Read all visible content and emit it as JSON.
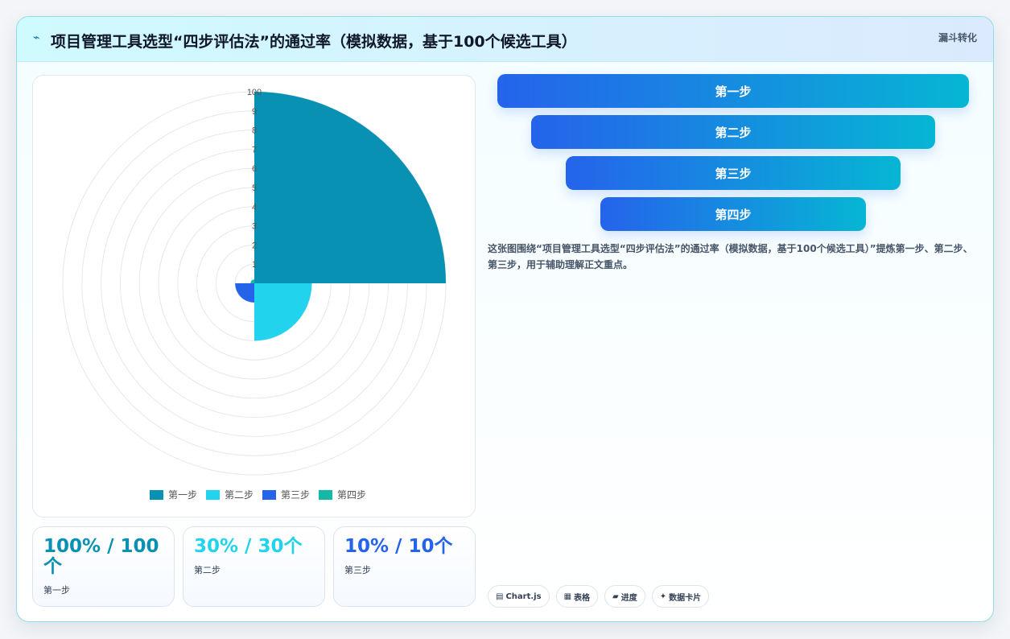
{
  "header": {
    "icon": "lightning-icon",
    "title": "项目管理工具选型“四步评估法”的通过率（模拟数据，基于100个候选工具）",
    "badge": "漏斗转化"
  },
  "chart_data": {
    "type": "polarArea",
    "categories": [
      "第一步",
      "第二步",
      "第三步",
      "第四步"
    ],
    "values": [
      100,
      30,
      10,
      2
    ],
    "colors": [
      "#0891b2",
      "#22d3ee",
      "#2563eb",
      "#14b8a6"
    ],
    "rlim": [
      0,
      100
    ],
    "ticks": [
      "1",
      "2",
      "3",
      "4",
      "5",
      "6",
      "7",
      "8",
      "9",
      "100"
    ],
    "legend_position": "bottom",
    "grid": true
  },
  "stats": [
    {
      "value": "100% / 100个",
      "label": "第一步",
      "color": "#0891b2"
    },
    {
      "value": "30% / 30个",
      "label": "第二步",
      "color": "#22d3ee"
    },
    {
      "value": "10% / 10个",
      "label": "第三步",
      "color": "#2563eb"
    }
  ],
  "funnel": [
    "第一步",
    "第二步",
    "第三步",
    "第四步"
  ],
  "description": "这张图围绕“项目管理工具选型“四步评估法”的通过率（模拟数据，基于100个候选工具）”提炼第一步、第二步、第三步，用于辅助理解正文重点。",
  "tags": [
    {
      "icon": "chart-icon",
      "glyph": "▤",
      "label": "Chart.js"
    },
    {
      "icon": "table-icon",
      "glyph": "▦",
      "label": "表格"
    },
    {
      "icon": "progress-icon",
      "glyph": "▰",
      "label": "进度"
    },
    {
      "icon": "sparkle-icon",
      "glyph": "✦",
      "label": "数据卡片"
    }
  ]
}
